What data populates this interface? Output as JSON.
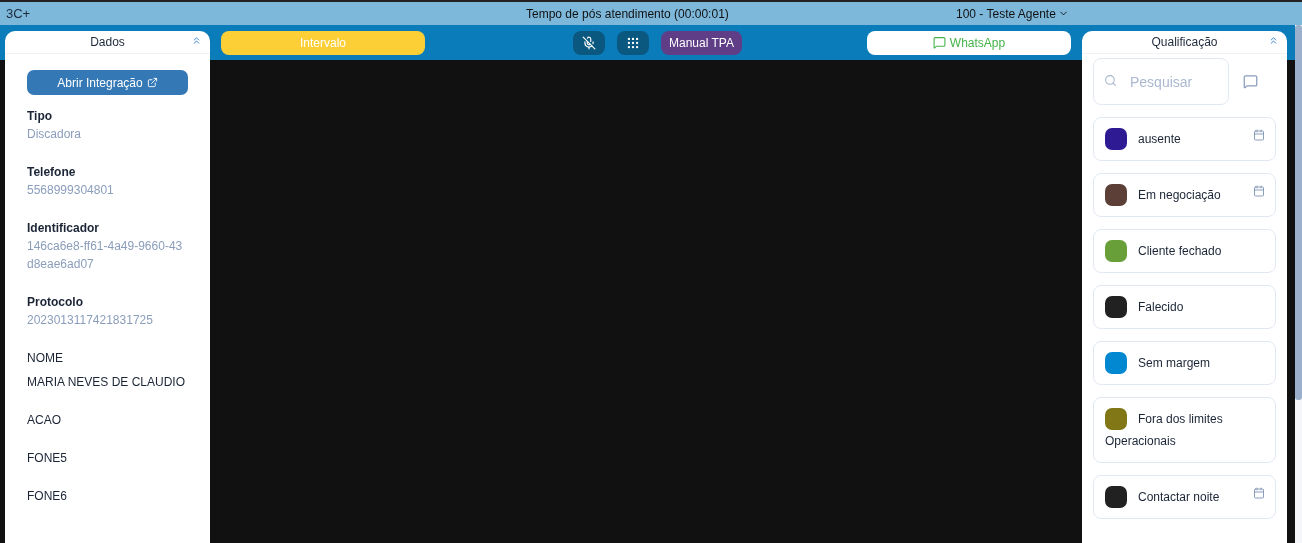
{
  "top_bar": {
    "logo": "3C+",
    "timer_text": "Tempo de pós atendimento (00:00:01)",
    "agent": "100 - Teste Agente"
  },
  "toolbar": {
    "pause_button": "Intervalo",
    "muted": true,
    "mode_badge": "Manual TPA",
    "whatsapp_button": "WhatsApp"
  },
  "data_panel": {
    "title": "Dados",
    "expanded": true,
    "integration_button": "Abrir Integração",
    "fields": [
      {
        "kind": "system",
        "label": "Tipo",
        "value": "Discadora"
      },
      {
        "kind": "system",
        "label": "Telefone",
        "value": "5568999304801"
      },
      {
        "kind": "system",
        "label": "Identificador",
        "value": "146ca6e8-ff61-4a49-9660-43d8eae6ad07"
      },
      {
        "kind": "system",
        "label": "Protocolo",
        "value": "2023013117421831725"
      },
      {
        "kind": "custom",
        "label": "NOME",
        "value": "MARIA NEVES DE CLAUDIO"
      },
      {
        "kind": "custom",
        "label": "ACAO"
      },
      {
        "kind": "custom",
        "label": "FONE5"
      },
      {
        "kind": "custom",
        "label": "FONE6"
      }
    ]
  },
  "qualification_panel": {
    "title": "Qualificação",
    "expanded": true,
    "search": {
      "placeholder": "Pesquisar"
    },
    "items": [
      {
        "label": "ausente",
        "color": "#2e1b93",
        "scheduled": true
      },
      {
        "label": "Em negociação",
        "color": "#5c4037",
        "scheduled": true
      },
      {
        "label": "Cliente fechado",
        "color": "#689f38",
        "scheduled": false
      },
      {
        "label": "Falecido",
        "color": "#212121",
        "scheduled": false
      },
      {
        "label": "Sem margem",
        "color": "#0288d1",
        "scheduled": false
      },
      {
        "label": "Fora dos limites Operacionais",
        "color": "#827717",
        "scheduled": false
      },
      {
        "label": "Contactar noite",
        "color": "#212121",
        "scheduled": true
      }
    ]
  }
}
